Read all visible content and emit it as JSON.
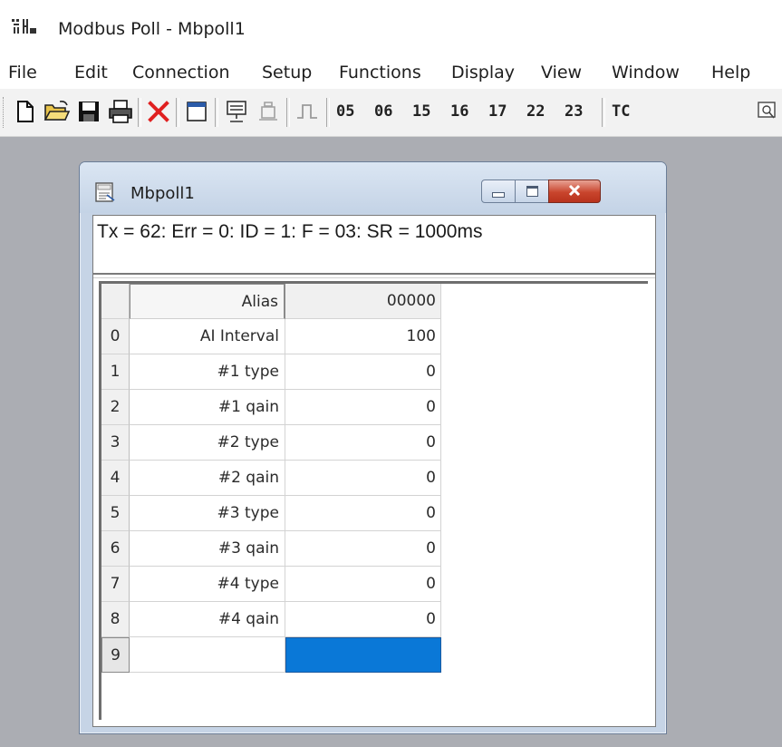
{
  "app": {
    "title": "Modbus Poll - Mbpoll1"
  },
  "menu": {
    "items": [
      "File",
      "Edit",
      "Connection",
      "Setup",
      "Functions",
      "Display",
      "View",
      "Window",
      "Help"
    ]
  },
  "toolbar": {
    "icons": [
      "new-file-icon",
      "open-folder-icon",
      "save-icon",
      "print-icon",
      "delete-icon",
      "window-icon",
      "connect-icon",
      "disconnect-icon",
      "pulse-icon"
    ],
    "function_codes": [
      "05",
      "06",
      "15",
      "16",
      "17",
      "22",
      "23"
    ],
    "tc_label": "TC"
  },
  "child_window": {
    "title": "Mbpoll1",
    "status": "Tx = 62: Err = 0: ID = 1: F = 03: SR = 1000ms"
  },
  "grid": {
    "headers": {
      "alias": "Alias",
      "value": "00000"
    },
    "rows": [
      {
        "index": "0",
        "alias": "AI Interval",
        "value": "100"
      },
      {
        "index": "1",
        "alias": "#1 type",
        "value": "0"
      },
      {
        "index": "2",
        "alias": "#1 qain",
        "value": "0"
      },
      {
        "index": "3",
        "alias": "#2 type",
        "value": "0"
      },
      {
        "index": "4",
        "alias": "#2 qain",
        "value": "0"
      },
      {
        "index": "5",
        "alias": "#3 type",
        "value": "0"
      },
      {
        "index": "6",
        "alias": "#3 qain",
        "value": "0"
      },
      {
        "index": "7",
        "alias": "#4 type",
        "value": "0"
      },
      {
        "index": "8",
        "alias": "#4 qain",
        "value": "0"
      },
      {
        "index": "9",
        "alias": "",
        "value": ""
      }
    ],
    "selected_row": 9
  },
  "colors": {
    "selection": "#0a78d7",
    "workspace": "#abadb3",
    "close_button": "#c9452d",
    "delete_icon": "#e02020"
  }
}
